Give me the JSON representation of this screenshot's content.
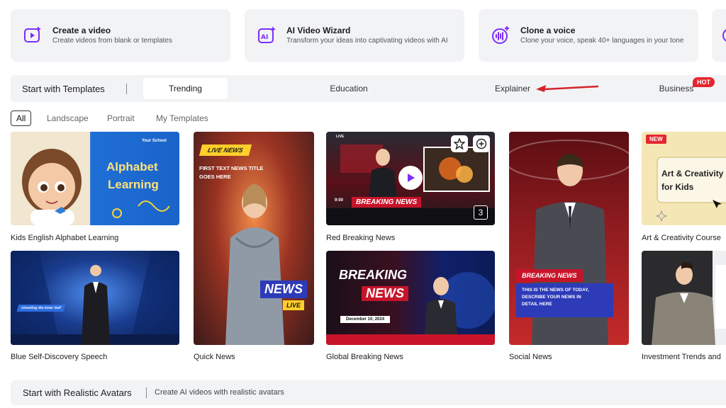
{
  "features": [
    {
      "title": "Create a video",
      "desc": "Create videos from blank or templates",
      "icon": "video-add-icon"
    },
    {
      "title": "AI Video Wizard",
      "desc": "Transform your ideas into captivating videos with AI",
      "icon": "ai-wizard-icon"
    },
    {
      "title": "Clone a voice",
      "desc": "Clone your voice, speak 40+ languages in your tone",
      "icon": "voice-clone-icon"
    }
  ],
  "templates_bar": {
    "title": "Start with Templates",
    "tabs": [
      "Trending",
      "Education",
      "Explainer",
      "Business"
    ],
    "active_tab": "Trending",
    "hot_badge": "HOT"
  },
  "filters": {
    "items": [
      "All",
      "Landscape",
      "Portrait",
      "My Templates"
    ],
    "active": "All"
  },
  "templates": [
    {
      "caption": "Kids English Alphabet Learning",
      "overlay": [
        "Your School",
        "Alphabet",
        "Learning"
      ]
    },
    {
      "caption": "Blue Self-Discovery Speech",
      "overlay": [
        "Unveiling the Inner Self"
      ]
    },
    {
      "caption": "Quick News",
      "overlay": [
        "LIVE NEWS",
        "FIRST TEXT NEWS TITLE",
        "GOES HERE",
        "NEWS",
        "LIVE"
      ]
    },
    {
      "caption": "Red Breaking News",
      "overlay": [
        "LIVE",
        "BREAKING NEWS",
        "9:00",
        "3"
      ]
    },
    {
      "caption": "Global Breaking News",
      "overlay": [
        "BREAKING",
        "NEWS",
        "December 10, 2024"
      ]
    },
    {
      "caption": "Social News",
      "overlay": [
        "BREAKING NEWS",
        "THIS IS THE  NEWS OF TODAY,",
        "DESCRIBE YOUR NEWS IN",
        "DETAIL HERE"
      ]
    },
    {
      "caption": "Art & Creativity Course",
      "overlay": [
        "NEW",
        "Art & Creativity",
        "for Kids"
      ]
    },
    {
      "caption": "Investment Trends and",
      "overlay": []
    }
  ],
  "avatars_bar": {
    "title": "Start with Realistic Avatars",
    "subtitle": "Create AI videos with realistic avatars"
  },
  "colors": {
    "accent": "#7b2ff7",
    "hot": "#e5262f",
    "panel": "#f2f3f5"
  }
}
